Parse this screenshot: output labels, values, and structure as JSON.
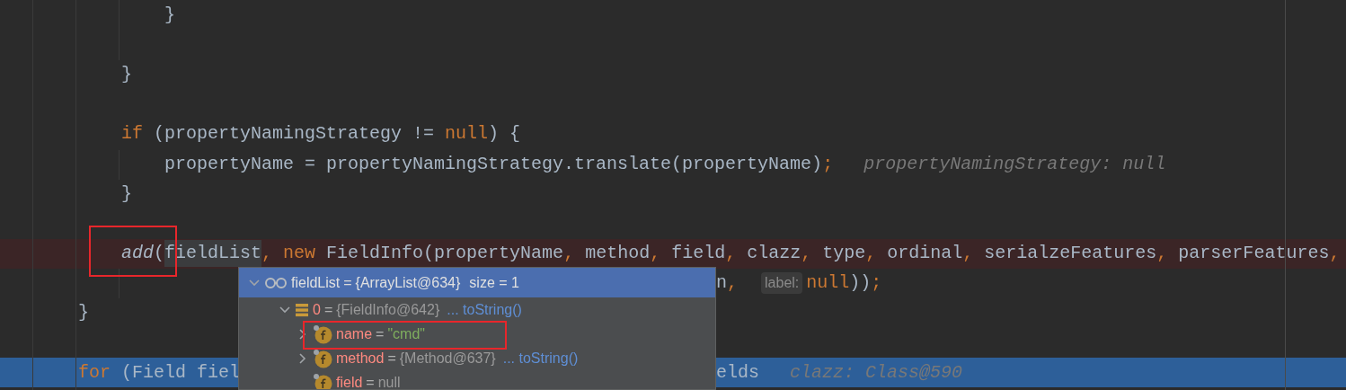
{
  "editor": {
    "lines": [
      {
        "kind": "code",
        "tokens": [
          {
            "text": "            }",
            "kind": "plain"
          }
        ]
      },
      {
        "kind": "blank"
      },
      {
        "kind": "code",
        "tokens": [
          {
            "text": "        }",
            "kind": "plain"
          }
        ]
      },
      {
        "kind": "blank"
      },
      {
        "kind": "code",
        "tokens": [
          {
            "text": "        if",
            "kind": "keyword"
          },
          {
            "text": " (propertyNamingStrategy != ",
            "kind": "plain"
          },
          {
            "text": "null",
            "kind": "keyword"
          },
          {
            "text": ") {",
            "kind": "plain"
          }
        ]
      },
      {
        "kind": "code",
        "tokens": [
          {
            "text": "            propertyName = propertyNamingStrategy.translate(propertyName)",
            "kind": "plain"
          },
          {
            "text": ";",
            "kind": "keyword"
          },
          {
            "text": "propertyNamingStrategy: null",
            "kind": "hint"
          }
        ]
      },
      {
        "kind": "code",
        "tokens": [
          {
            "text": "        }",
            "kind": "plain"
          }
        ]
      },
      {
        "kind": "blank"
      },
      {
        "kind": "code",
        "breakpoint": true,
        "tokens": [
          {
            "text": "        add",
            "kind": "call"
          },
          {
            "text": "(",
            "kind": "plain"
          },
          {
            "text": "fieldList",
            "kind": "usage"
          },
          {
            "text": ", new",
            "kind": "keyword"
          },
          {
            "text": " FieldInfo(propertyName",
            "kind": "plain"
          },
          {
            "text": ",",
            "kind": "keyword"
          },
          {
            "text": " method",
            "kind": "plain"
          },
          {
            "text": ",",
            "kind": "keyword"
          },
          {
            "text": " field",
            "kind": "plain"
          },
          {
            "text": ",",
            "kind": "keyword"
          },
          {
            "text": " clazz",
            "kind": "plain"
          },
          {
            "text": ",",
            "kind": "keyword"
          },
          {
            "text": " type",
            "kind": "plain"
          },
          {
            "text": ",",
            "kind": "keyword"
          },
          {
            "text": " ordinal",
            "kind": "plain"
          },
          {
            "text": ",",
            "kind": "keyword"
          },
          {
            "text": " serialzeFeatures",
            "kind": "plain"
          },
          {
            "text": ",",
            "kind": "keyword"
          },
          {
            "text": " parserFeatures",
            "kind": "plain"
          },
          {
            "text": ",",
            "kind": "keyword"
          }
        ]
      },
      {
        "kind": "split",
        "after": [
          {
            "text": "n",
            "kind": "plain"
          },
          {
            "text": ",",
            "kind": "keyword"
          },
          {
            "text": "label:",
            "kind": "inlay"
          },
          {
            "text": "null",
            "kind": "keyword"
          },
          {
            "text": "))",
            "kind": "plain"
          },
          {
            "text": ";",
            "kind": "keyword"
          }
        ]
      },
      {
        "kind": "code",
        "tokens": [
          {
            "text": "    }",
            "kind": "plain"
          }
        ]
      },
      {
        "kind": "blank"
      },
      {
        "kind": "split",
        "current": true,
        "before": [
          {
            "text": "    for",
            "kind": "keyword"
          },
          {
            "text": " (Field fiel",
            "kind": "plain"
          }
        ],
        "after": [
          {
            "text": "elds",
            "kind": "plain"
          },
          {
            "text": "clazz: Class@590",
            "kind": "hint"
          }
        ]
      }
    ]
  },
  "debug_popup": {
    "nodes": [
      {
        "kind": "watch",
        "name": "fieldList",
        "equals": "=",
        "value": "{ArrayList@634}",
        "extra": "size = 1",
        "expanded": true,
        "selected": true,
        "children": [
          {
            "kind": "array",
            "name": "0",
            "equals": "=",
            "value": "{FieldInfo@642}",
            "link": "... toString()",
            "expanded": true,
            "selected": false,
            "children": [
              {
                "kind": "string-field",
                "name": "name",
                "equals": "=",
                "value": "\"cmd\"",
                "expanded": false,
                "selected": false
              },
              {
                "kind": "field",
                "name": "method",
                "equals": "=",
                "value": "{Method@637}",
                "link": "... toString()",
                "expanded": false,
                "selected": false
              },
              {
                "kind": "field",
                "name": "field",
                "equals": "=",
                "value": "null",
                "selected": false
              }
            ]
          }
        ]
      }
    ]
  }
}
